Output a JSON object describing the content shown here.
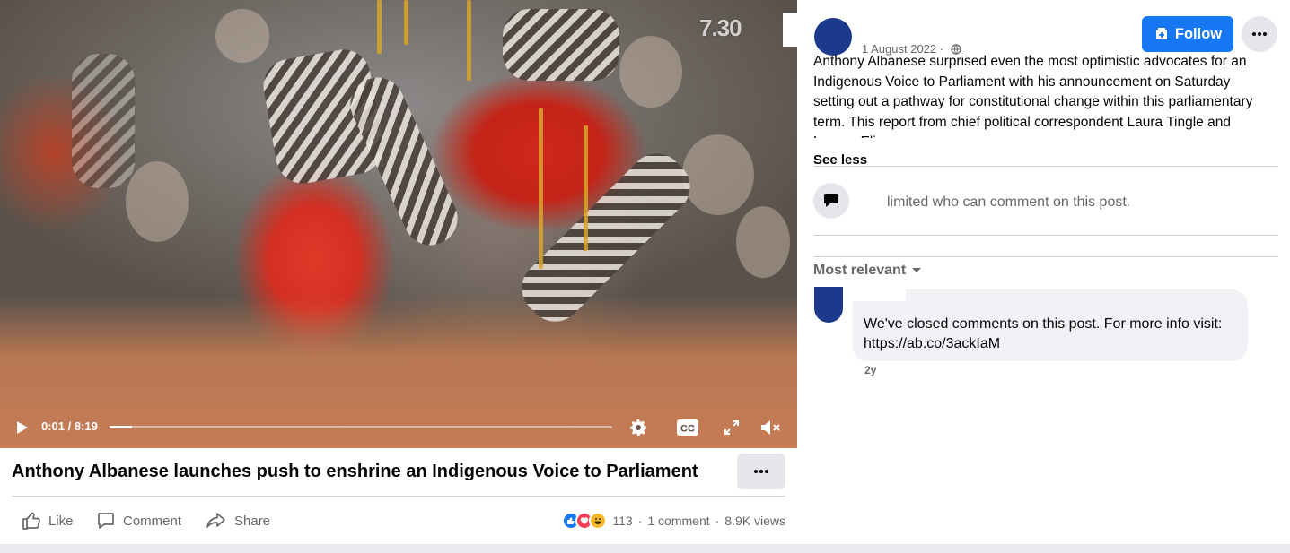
{
  "video": {
    "watermark": "7.30",
    "time_display": "0:01 / 8:19",
    "progress_fraction": 0.045,
    "controls": {
      "play": "play-icon",
      "settings": "gear-icon",
      "captions": "closed-captions-icon",
      "fullscreen": "fullscreen-icon",
      "volume": "muted-volume-icon"
    }
  },
  "title": {
    "text": "Anthony Albanese launches push to enshrine an Indigenous Voice to Parliament",
    "more_icon": "ellipsis-icon"
  },
  "actions": {
    "like_label": "Like",
    "comment_label": "Comment",
    "share_label": "Share"
  },
  "stats": {
    "reaction_count": "113",
    "separator_1": "·",
    "comments": "1 comment",
    "separator_2": "·",
    "views": "8.9K views",
    "reaction_icons": [
      "like-reaction-icon",
      "love-reaction-icon",
      "haha-reaction-icon"
    ]
  },
  "post": {
    "date": "1 August 2022 ·",
    "text": "Anthony Albanese surprised even the most optimistic advocates for an Indigenous Voice to Parliament with his announcement on Saturday setting out a pathway for constitutional change within this parliamentary term. This report from chief political correspondent Laura Tingle and Lauren Elise",
    "see_less": "See less",
    "follow_label": "Follow",
    "limited_comments": "limited who can comment on this post.",
    "sort_label": "Most relevant"
  },
  "comment": {
    "text": "We've closed comments on this post. For more info visit: https://ab.co/3ackIaM",
    "time": "2y"
  },
  "colors": {
    "accent": "#1877f2",
    "avatar": "#1b3a8c",
    "secondary_text": "#65676b",
    "bubble": "#f0f2f5"
  }
}
